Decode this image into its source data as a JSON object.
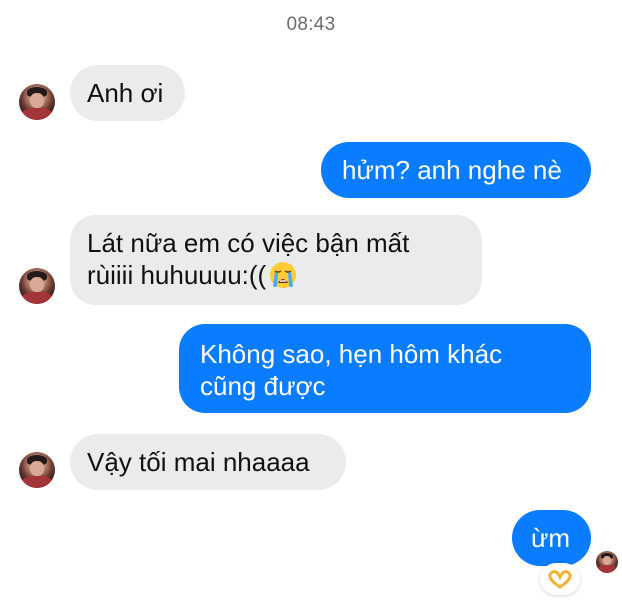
{
  "chat": {
    "timestamp": "08:43",
    "messages": [
      {
        "side": "in",
        "line1": "Anh ơi"
      },
      {
        "side": "out",
        "line1": "hửm? anh nghe nè"
      },
      {
        "side": "in",
        "line1": "Lát nữa em có việc bận mất",
        "line2": "rùiiii huhuuuu:((",
        "emoji": "loudly-crying-face-icon"
      },
      {
        "side": "out",
        "line1": "Không sao, hẹn hôm khác",
        "line2": "cũng được"
      },
      {
        "side": "in",
        "line1": "Vậy tối mai nhaaaa"
      },
      {
        "side": "out",
        "line1": "ừm",
        "reaction": "heart-hands-icon"
      }
    ]
  },
  "colors": {
    "incoming_bubble": "#ebebeb",
    "outgoing_bubble": "#0a7cff",
    "timestamp_text": "#6b6b6b"
  }
}
